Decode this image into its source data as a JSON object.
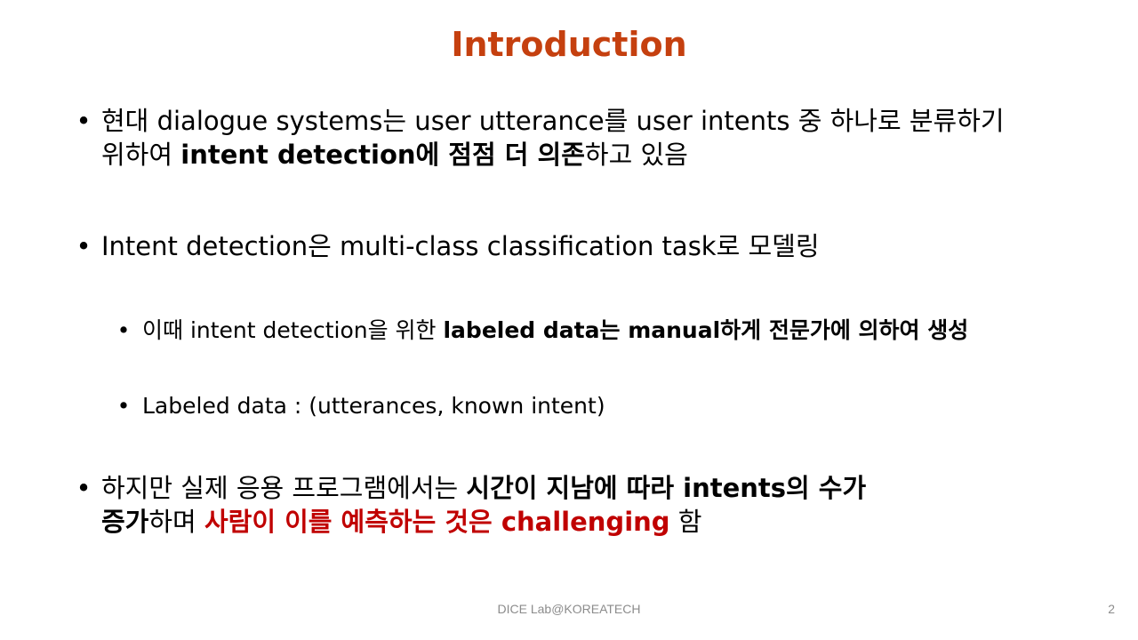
{
  "slide": {
    "title": "Introduction",
    "bullet1": {
      "marker": "•",
      "line1": "현대 dialogue systems는 user utterance를 user intents 중 하나로 분류하기",
      "line2_plain_a": "위하여 ",
      "line2_bold": "intent detection에 점점 더 의존",
      "line2_plain_b": "하고 있음"
    },
    "bullet2": {
      "marker": "•",
      "text": "Intent detection은 multi-class classification task로 모델링"
    },
    "sub1": {
      "marker": "•",
      "plain": "이때 intent detection을 위한 ",
      "bold": "labeled data는 manual하게 전문가에 의하여 생성"
    },
    "sub2": {
      "marker": "•",
      "text": "Labeled data : (utterances, known intent)"
    },
    "bullet3": {
      "marker": "•",
      "line1_plain": "하지만 실제 응용 프로그램에서는 ",
      "line1_bold": "시간이 지남에 따라 intents의 수가",
      "line2_bold": "증가",
      "line2_plain_a": "하며 ",
      "line2_red": "사람이 이를 예측하는 것은 challenging",
      "line2_plain_b": " 함"
    },
    "footer": "DICE Lab@KOREATECH",
    "page_number": "2",
    "colors": {
      "title": "#c5400f",
      "emphasis_red": "#c00000",
      "footer_gray": "#8c8c8c"
    }
  }
}
